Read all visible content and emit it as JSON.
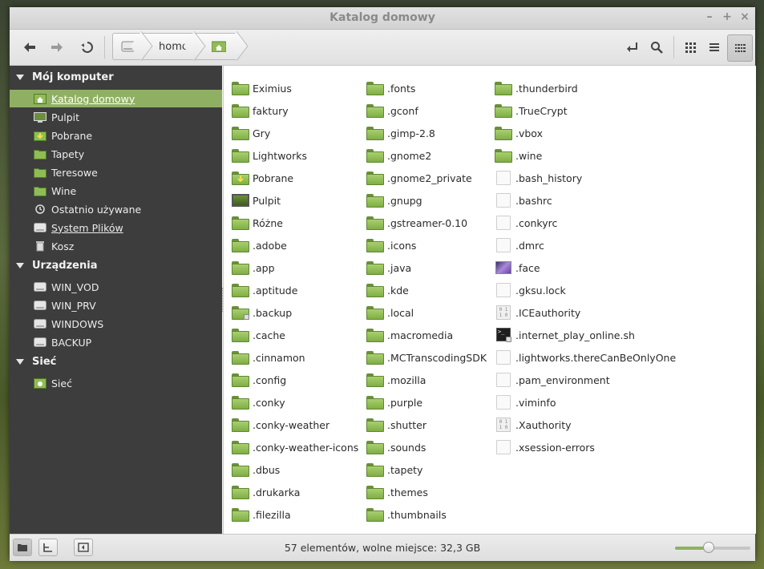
{
  "window": {
    "title": "Katalog domowy"
  },
  "window_controls": {
    "minimize": "–",
    "maximize": "+",
    "close": "×"
  },
  "breadcrumb": {
    "items": [
      "",
      "home",
      ""
    ]
  },
  "sidebar": {
    "sections": [
      {
        "label": "Mój komputer",
        "items": [
          {
            "label": "Katalog domowy",
            "icon": "home-folder-icon",
            "selected": true,
            "underline": true
          },
          {
            "label": "Pulpit",
            "icon": "desktop-icon"
          },
          {
            "label": "Pobrane",
            "icon": "downloads-folder-icon"
          },
          {
            "label": "Tapety",
            "icon": "folder-icon"
          },
          {
            "label": "Teresowe",
            "icon": "folder-icon"
          },
          {
            "label": "Wine",
            "icon": "folder-icon"
          },
          {
            "label": "Ostatnio używane",
            "icon": "recent-icon"
          },
          {
            "label": "System Plików",
            "icon": "drive-icon",
            "underline": true
          },
          {
            "label": "Kosz",
            "icon": "trash-icon"
          }
        ]
      },
      {
        "label": "Urządzenia",
        "items": [
          {
            "label": "WIN_VOD",
            "icon": "drive-icon"
          },
          {
            "label": "WIN_PRV",
            "icon": "drive-icon"
          },
          {
            "label": "WINDOWS",
            "icon": "drive-icon"
          },
          {
            "label": "BACKUP",
            "icon": "drive-icon"
          }
        ]
      },
      {
        "label": "Sieć",
        "items": [
          {
            "label": "Sieć",
            "icon": "network-icon"
          }
        ]
      }
    ]
  },
  "files": {
    "col1": [
      {
        "name": "Eximius",
        "type": "folder"
      },
      {
        "name": "faktury",
        "type": "folder"
      },
      {
        "name": "Gry",
        "type": "folder"
      },
      {
        "name": "Lightworks",
        "type": "folder"
      },
      {
        "name": "Pobrane",
        "type": "downloads"
      },
      {
        "name": "Pulpit",
        "type": "desktop"
      },
      {
        "name": "Różne",
        "type": "folder"
      },
      {
        "name": ".adobe",
        "type": "folder"
      },
      {
        "name": ".app",
        "type": "folder"
      },
      {
        "name": ".aptitude",
        "type": "folder"
      },
      {
        "name": ".backup",
        "type": "folder-locked"
      },
      {
        "name": ".cache",
        "type": "folder"
      },
      {
        "name": ".cinnamon",
        "type": "folder"
      },
      {
        "name": ".config",
        "type": "folder"
      },
      {
        "name": ".conky",
        "type": "folder"
      },
      {
        "name": ".conky-weather",
        "type": "folder"
      },
      {
        "name": ".conky-weather-icons",
        "type": "folder"
      },
      {
        "name": ".dbus",
        "type": "folder"
      },
      {
        "name": ".drukarka",
        "type": "folder"
      },
      {
        "name": ".filezilla",
        "type": "folder"
      }
    ],
    "col2": [
      {
        "name": ".fonts",
        "type": "folder"
      },
      {
        "name": ".gconf",
        "type": "folder"
      },
      {
        "name": ".gimp-2.8",
        "type": "folder"
      },
      {
        "name": ".gnome2",
        "type": "folder"
      },
      {
        "name": ".gnome2_private",
        "type": "folder"
      },
      {
        "name": ".gnupg",
        "type": "folder"
      },
      {
        "name": ".gstreamer-0.10",
        "type": "folder"
      },
      {
        "name": ".icons",
        "type": "folder"
      },
      {
        "name": ".java",
        "type": "folder"
      },
      {
        "name": ".kde",
        "type": "folder"
      },
      {
        "name": ".local",
        "type": "folder"
      },
      {
        "name": ".macromedia",
        "type": "folder"
      },
      {
        "name": ".MCTranscodingSDK",
        "type": "folder"
      },
      {
        "name": ".mozilla",
        "type": "folder"
      },
      {
        "name": ".purple",
        "type": "folder"
      },
      {
        "name": ".shutter",
        "type": "folder"
      },
      {
        "name": ".sounds",
        "type": "folder"
      },
      {
        "name": ".tapety",
        "type": "folder"
      },
      {
        "name": ".themes",
        "type": "folder"
      },
      {
        "name": ".thumbnails",
        "type": "folder"
      }
    ],
    "col3": [
      {
        "name": ".thunderbird",
        "type": "folder"
      },
      {
        "name": ".TrueCrypt",
        "type": "folder"
      },
      {
        "name": ".vbox",
        "type": "folder"
      },
      {
        "name": ".wine",
        "type": "folder"
      },
      {
        "name": ".bash_history",
        "type": "text"
      },
      {
        "name": ".bashrc",
        "type": "text"
      },
      {
        "name": ".conkyrc",
        "type": "text"
      },
      {
        "name": ".dmrc",
        "type": "text"
      },
      {
        "name": ".face",
        "type": "image"
      },
      {
        "name": ".gksu.lock",
        "type": "text"
      },
      {
        "name": ".ICEauthority",
        "type": "binary"
      },
      {
        "name": ".internet_play_online.sh",
        "type": "script"
      },
      {
        "name": ".lightworks.thereCanBeOnlyOne",
        "type": "text"
      },
      {
        "name": ".pam_environment",
        "type": "text"
      },
      {
        "name": ".viminfo",
        "type": "text"
      },
      {
        "name": ".Xauthority",
        "type": "binary"
      },
      {
        "name": ".xsession-errors",
        "type": "text"
      }
    ]
  },
  "statusbar": {
    "text": "57 elementów, wolne miejsce: 32,3 GB",
    "zoom_level": 0.45
  },
  "colors": {
    "accent": "#8fb063",
    "sidebar_bg": "#3d3d3d",
    "folder": "#8fbc55"
  }
}
